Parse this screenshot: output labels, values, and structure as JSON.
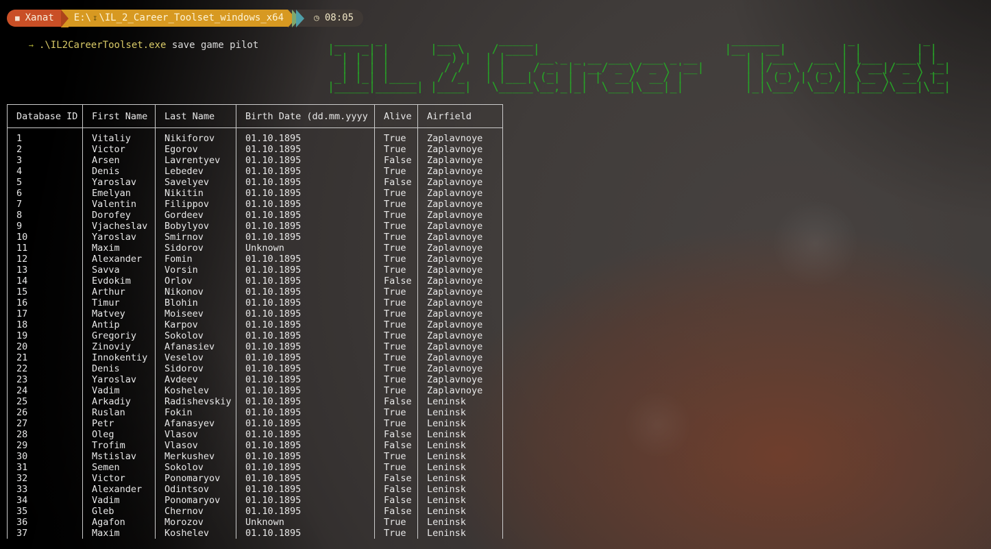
{
  "terminal_bar": {
    "window_icon": "■",
    "session_label": "Xanat",
    "path_drive": "E:\\",
    "path_icon": "↧",
    "path_dir": "\\IL_2_Career_Toolset_windows_x64",
    "clock_icon": "◷",
    "time": "08:05"
  },
  "command_line": {
    "prompt_symbol": "→",
    "command": ".\\IL2CareerToolset.exe",
    "arguments": " save game pilot"
  },
  "ascii_title": {
    "text": "IL 2 Career Toolset",
    "color": "#28a228",
    "lines": [
      " _____ _        ___      _____                             _______          _          _   ",
      "|_   _| |      |__ \\    / ____|                           |__   __|        | |        | |  ",
      "  | | | |         ) |  | |     __ _ _ __ ___  ___ _ __       | | ___   ___ | |___  ___| |_ ",
      "  | | | |        / /   | |    / _` | '__/ _ \\/ _ \\ '__|      | |/ _ \\ / _ \\| / __|/ _ \\ __|",
      " _| |_| |____   / /_   | |___| (_| | | |  __/  __/ |         | | (_) | (_) | \\__ \\  __/ |_ ",
      "|_____|______| |____|   \\_____\\__,_|_|  \\___|\\___|_|         |_|\\___/ \\___/|_|___/\\___|\\__|"
    ]
  },
  "table": {
    "columns": [
      "Database ID",
      "First Name",
      "Last Name",
      "Birth Date (dd.mm.yyyy",
      "Alive",
      "Airfield"
    ],
    "rows": [
      [
        "1",
        "Vitaliy",
        "Nikiforov",
        "01.10.1895",
        "True",
        "Zaplavnoye"
      ],
      [
        "2",
        "Victor",
        "Egorov",
        "01.10.1895",
        "True",
        "Zaplavnoye"
      ],
      [
        "3",
        "Arsen",
        "Lavrentyev",
        "01.10.1895",
        "False",
        "Zaplavnoye"
      ],
      [
        "4",
        "Denis",
        "Lebedev",
        "01.10.1895",
        "True",
        "Zaplavnoye"
      ],
      [
        "5",
        "Yaroslav",
        "Savelyev",
        "01.10.1895",
        "False",
        "Zaplavnoye"
      ],
      [
        "6",
        "Emelyan",
        "Nikitin",
        "01.10.1895",
        "True",
        "Zaplavnoye"
      ],
      [
        "7",
        "Valentin",
        "Filippov",
        "01.10.1895",
        "True",
        "Zaplavnoye"
      ],
      [
        "8",
        "Dorofey",
        "Gordeev",
        "01.10.1895",
        "True",
        "Zaplavnoye"
      ],
      [
        "9",
        "Vjacheslav",
        "Bobylyov",
        "01.10.1895",
        "True",
        "Zaplavnoye"
      ],
      [
        "10",
        "Yaroslav",
        "Smirnov",
        "01.10.1895",
        "True",
        "Zaplavnoye"
      ],
      [
        "11",
        "Maxim",
        "Sidorov",
        "Unknown",
        "True",
        "Zaplavnoye"
      ],
      [
        "12",
        "Alexander",
        "Fomin",
        "01.10.1895",
        "True",
        "Zaplavnoye"
      ],
      [
        "13",
        "Savva",
        "Vorsin",
        "01.10.1895",
        "True",
        "Zaplavnoye"
      ],
      [
        "14",
        "Evdokim",
        "Orlov",
        "01.10.1895",
        "False",
        "Zaplavnoye"
      ],
      [
        "15",
        "Arthur",
        "Nikonov",
        "01.10.1895",
        "True",
        "Zaplavnoye"
      ],
      [
        "16",
        "Timur",
        "Blohin",
        "01.10.1895",
        "True",
        "Zaplavnoye"
      ],
      [
        "17",
        "Matvey",
        "Moiseev",
        "01.10.1895",
        "True",
        "Zaplavnoye"
      ],
      [
        "18",
        "Antip",
        "Karpov",
        "01.10.1895",
        "True",
        "Zaplavnoye"
      ],
      [
        "19",
        "Gregoriy",
        "Sokolov",
        "01.10.1895",
        "True",
        "Zaplavnoye"
      ],
      [
        "20",
        "Zinoviy",
        "Afanasiev",
        "01.10.1895",
        "True",
        "Zaplavnoye"
      ],
      [
        "21",
        "Innokentiy",
        "Veselov",
        "01.10.1895",
        "True",
        "Zaplavnoye"
      ],
      [
        "22",
        "Denis",
        "Sidorov",
        "01.10.1895",
        "True",
        "Zaplavnoye"
      ],
      [
        "23",
        "Yaroslav",
        "Avdeev",
        "01.10.1895",
        "True",
        "Zaplavnoye"
      ],
      [
        "24",
        "Vadim",
        "Koshelev",
        "01.10.1895",
        "True",
        "Zaplavnoye"
      ],
      [
        "25",
        "Arkadiy",
        "Radishevskiy",
        "01.10.1895",
        "False",
        "Leninsk"
      ],
      [
        "26",
        "Ruslan",
        "Fokin",
        "01.10.1895",
        "True",
        "Leninsk"
      ],
      [
        "27",
        "Petr",
        "Afanasyev",
        "01.10.1895",
        "True",
        "Leninsk"
      ],
      [
        "28",
        "Oleg",
        "Vlasov",
        "01.10.1895",
        "False",
        "Leninsk"
      ],
      [
        "29",
        "Trofim",
        "Vlasov",
        "01.10.1895",
        "False",
        "Leninsk"
      ],
      [
        "30",
        "Mstislav",
        "Merkushev",
        "01.10.1895",
        "True",
        "Leninsk"
      ],
      [
        "31",
        "Semen",
        "Sokolov",
        "01.10.1895",
        "True",
        "Leninsk"
      ],
      [
        "32",
        "Victor",
        "Ponomaryov",
        "01.10.1895",
        "False",
        "Leninsk"
      ],
      [
        "33",
        "Alexander",
        "Odintsov",
        "01.10.1895",
        "False",
        "Leninsk"
      ],
      [
        "34",
        "Vadim",
        "Ponomaryov",
        "01.10.1895",
        "False",
        "Leninsk"
      ],
      [
        "35",
        "Gleb",
        "Chernov",
        "01.10.1895",
        "False",
        "Leninsk"
      ],
      [
        "36",
        "Agafon",
        "Morozov",
        "Unknown",
        "True",
        "Leninsk"
      ],
      [
        "37",
        "Maxim",
        "Koshelev",
        "01.10.1895",
        "True",
        "Leninsk"
      ]
    ]
  },
  "colors": {
    "accent_green": "#28a228",
    "segment_red": "#c94f26",
    "segment_amber": "#d79921",
    "chevron_green": "#7fa86d",
    "chevron_teal": "#4f9fa8",
    "table_border": "#cdcdcd"
  }
}
